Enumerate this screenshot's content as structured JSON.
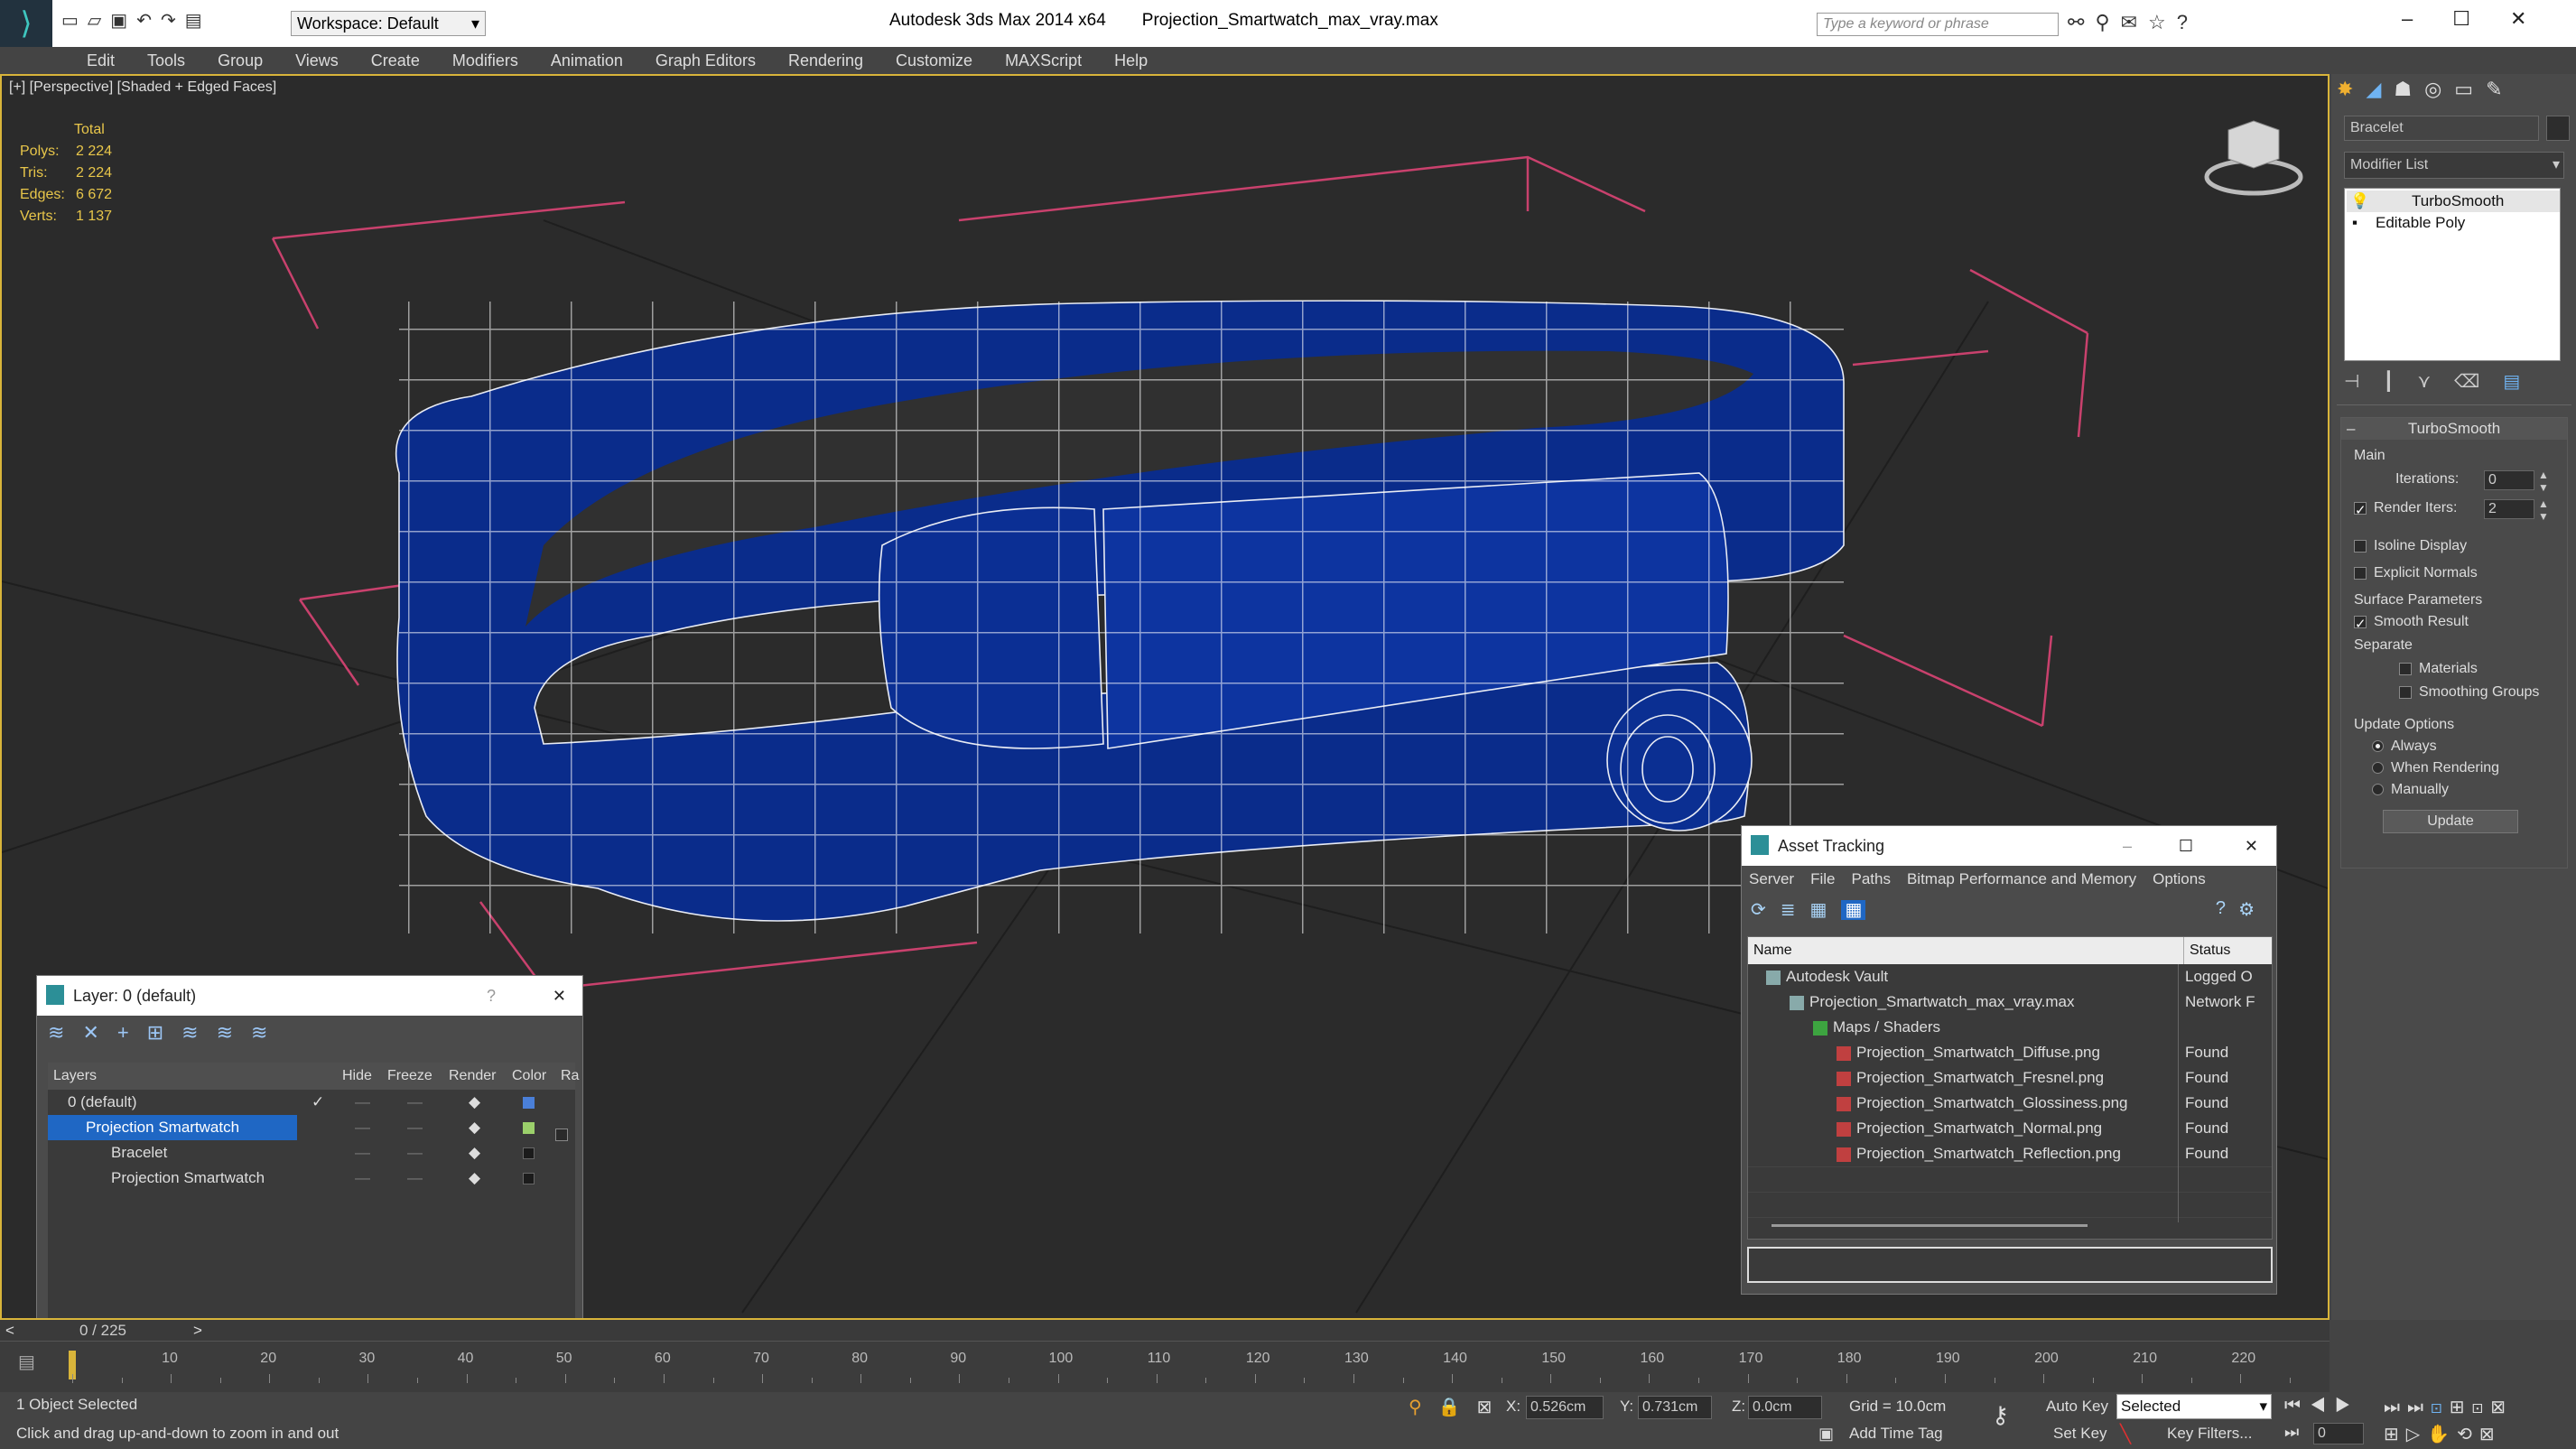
{
  "app": {
    "title": "Autodesk 3ds Max  2014 x64",
    "file": "Projection_Smartwatch_max_vray.max",
    "workspace": "Workspace: Default",
    "search_placeholder": "Type a keyword or phrase"
  },
  "menu": [
    "Edit",
    "Tools",
    "Group",
    "Views",
    "Create",
    "Modifiers",
    "Animation",
    "Graph Editors",
    "Rendering",
    "Customize",
    "MAXScript",
    "Help"
  ],
  "viewport": {
    "label": "[+] [Perspective] [Shaded + Edged Faces]",
    "stats": {
      "header": "Total",
      "polys_label": "Polys:",
      "polys": "2 224",
      "tris_label": "Tris:",
      "tris": "2 224",
      "edges_label": "Edges:",
      "edges": "6 672",
      "verts_label": "Verts:",
      "verts": "1 137"
    }
  },
  "cmd": {
    "object_name": "Bracelet",
    "modifier_list": "Modifier List",
    "stack": [
      "TurboSmooth",
      "Editable Poly"
    ],
    "rollout": "TurboSmooth",
    "main": "Main",
    "iterations_label": "Iterations:",
    "iterations": "0",
    "render_iters_label": "Render Iters:",
    "render_iters": "2",
    "isoline": "Isoline Display",
    "explicit": "Explicit Normals",
    "surface_params": "Surface Parameters",
    "smooth_result": "Smooth Result",
    "separate": "Separate",
    "materials": "Materials",
    "smoothing_groups": "Smoothing Groups",
    "update_options": "Update Options",
    "always": "Always",
    "when_rendering": "When Rendering",
    "manually": "Manually",
    "update": "Update"
  },
  "layer_win": {
    "title": "Layer: 0 (default)",
    "help": "?",
    "cols": [
      "Layers",
      "Hide",
      "Freeze",
      "Render",
      "Color",
      "Ra"
    ],
    "rows": [
      {
        "name": "0 (default)",
        "color": "#4a7fd8"
      },
      {
        "name": "Projection Smartwatch",
        "color": "#9bd06b"
      },
      {
        "name": "Bracelet",
        "color": "#1b1b1b"
      },
      {
        "name": "Projection Smartwatch",
        "color": "#1b1b1b"
      }
    ]
  },
  "asset_win": {
    "title": "Asset Tracking",
    "menu": [
      "Server",
      "File",
      "Paths",
      "Bitmap Performance and Memory",
      "Options"
    ],
    "col_name": "Name",
    "col_status": "Status",
    "rows": [
      {
        "name": "Autodesk Vault",
        "status": "Logged O",
        "indent": 0
      },
      {
        "name": "Projection_Smartwatch_max_vray.max",
        "status": "Network F",
        "indent": 1
      },
      {
        "name": "Maps / Shaders",
        "status": "",
        "indent": 2
      },
      {
        "name": "Projection_Smartwatch_Diffuse.png",
        "status": "Found",
        "indent": 3
      },
      {
        "name": "Projection_Smartwatch_Fresnel.png",
        "status": "Found",
        "indent": 3
      },
      {
        "name": "Projection_Smartwatch_Glossiness.png",
        "status": "Found",
        "indent": 3
      },
      {
        "name": "Projection_Smartwatch_Normal.png",
        "status": "Found",
        "indent": 3
      },
      {
        "name": "Projection_Smartwatch_Reflection.png",
        "status": "Found",
        "indent": 3
      }
    ]
  },
  "timeline": {
    "frame": "0 / 225",
    "ticks": [
      "10",
      "20",
      "30",
      "40",
      "50",
      "60",
      "70",
      "80",
      "90",
      "100",
      "110",
      "120",
      "130",
      "140",
      "150",
      "160",
      "170",
      "180",
      "190",
      "200",
      "210",
      "220"
    ]
  },
  "status": {
    "selected": "1 Object Selected",
    "hint": "Click and drag up-and-down to zoom in and out",
    "x_label": "X:",
    "x": "0.526cm",
    "y_label": "Y:",
    "y": "0.731cm",
    "z_label": "Z:",
    "z": "0.0cm",
    "grid": "Grid = 10.0cm",
    "auto_key": "Auto Key",
    "selected_mode": "Selected",
    "set_key": "Set Key",
    "key_filters": "Key Filters...",
    "add_time_tag": "Add Time Tag",
    "frame_field": "0"
  },
  "colors": {
    "accent": "#1f67c4",
    "mesh": "#0d2f8c",
    "gizmo": "#c0406a",
    "stat": "#e8c64a"
  }
}
